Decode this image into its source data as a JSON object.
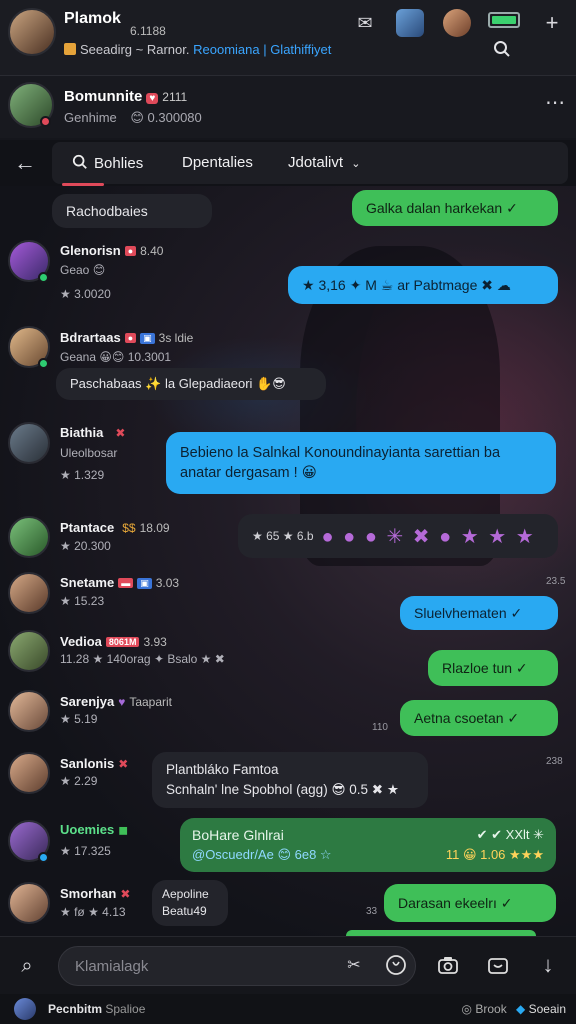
{
  "top": {
    "title": "Plamok",
    "count": "6.1188",
    "subtitle_a": "Seeadirg ~ Rarnor.",
    "subtitle_b": "Reoomiana | Glathiffiyet"
  },
  "channel": {
    "name": "Bomunnite",
    "badge": "♥",
    "num": "2111",
    "sub_a": "Genhime",
    "sub_b": "😊 0.300080"
  },
  "tabs": {
    "tab1": "Bohlies",
    "tab2": "Dpentalies",
    "tab3": "Jdotalivt"
  },
  "messages": [
    {
      "type": "partial",
      "text": "Rachodbaies"
    },
    {
      "type": "green-out",
      "text": "Galka dalan harkekan ✓"
    },
    {
      "name": "Glenorisn",
      "meta": "8.40",
      "sub1": "Geao 😊",
      "sub2": "★ 3.0020"
    },
    {
      "type": "blue-out",
      "text": "★ 3,16 ✦ M ☕ ar Pabtmage ✖ ☁"
    },
    {
      "name": "Bdrartaas",
      "meta": "3s ldie",
      "sub1": "Geana 😀😊 10.3001",
      "bubble": "Paschabaas ✨ la Glepadiaeori ✋😎"
    },
    {
      "name": "Biathia",
      "meta": "",
      "sub1": "Uleolbosar",
      "sub2": "★ 1.329"
    },
    {
      "type": "blue-out-2",
      "line1": "Bebieno la Salnkal Konoundinayianta sarettian ba",
      "line2": "anatar dergasam ! 😀"
    },
    {
      "name": "Ptantace",
      "meta": "18.09",
      "sub1": "★ 20.300",
      "reactions_label": "★ 65 ★ 6.b",
      "reactions": "● ● ● ✳ ✖ ● ★ ★ ★"
    },
    {
      "name": "Snetame",
      "meta": "3.03",
      "sub1": "★ 15.23",
      "time": "23.5"
    },
    {
      "type": "blue-out-3",
      "text": "Sluelvhematen ✓"
    },
    {
      "name": "Vedioa",
      "meta": "3.93",
      "badge": "8061M",
      "sub1": "11.28 ★ 140orag ✦ Bsalo ★ ✖"
    },
    {
      "type": "green-out-2",
      "text": "Rlazloe tun ✓"
    },
    {
      "name": "Sarenjya",
      "meta": "Taaparit",
      "sub1": "★ 5.19"
    },
    {
      "type": "green-out-3",
      "text": "Aetna csoetan ✓",
      "time": "110"
    },
    {
      "name": "Sanlonis",
      "meta": "",
      "sub1": "★ 2.29",
      "bubble1": "Plantbláko Famtoa",
      "bubble2": "Scnhaln' lne Spobhol (agg) 😎 0.5 ✖ ★",
      "time": "238"
    },
    {
      "name": "Uoemies",
      "meta": "",
      "sub1": "★ 17.325",
      "card_title": "BoHare Glnlrai",
      "card_sub": "@Oscuedr/Ae 😊 6e8 ☆",
      "card_right": "✔ ✔ XXlt ✳",
      "card_right2": "11 😀 1.06 ★★★"
    },
    {
      "name": "Smorhan",
      "meta": "",
      "sub1": "★ fø ★ 4.13",
      "bubble1": "Aepoline",
      "bubble2": "Beatu49",
      "out": "Darasan ekeelrı ✓",
      "time": "33"
    }
  ],
  "composer": {
    "placeholder": "Klamialagk"
  },
  "footer": {
    "left_a": "Pecnbitm",
    "left_b": "Spalioe",
    "right_a": "Brook",
    "right_b": "Soeain"
  },
  "colors": {
    "green": "#3fbf58",
    "blue": "#29a9f2",
    "accent": "#e04a5a"
  }
}
